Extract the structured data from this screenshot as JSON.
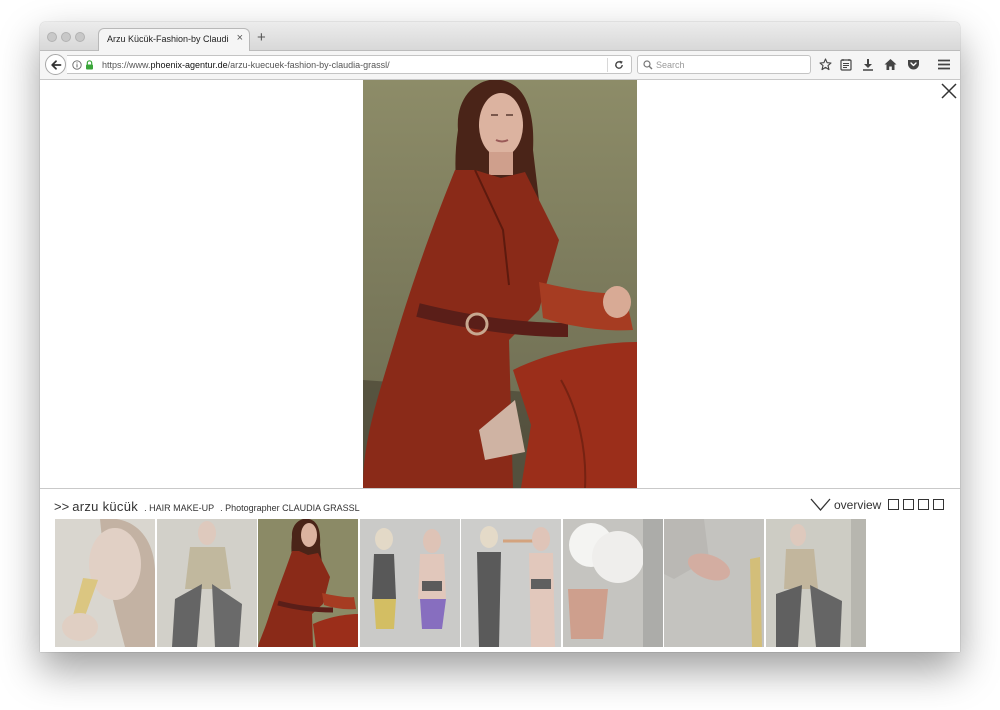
{
  "browser": {
    "tab_title": "Arzu Kücük-Fashion-by Claudia G",
    "tab_close": "×",
    "new_tab": "+",
    "url_prefix": "https://www.",
    "url_host": "phoenix-agentur.de",
    "url_path": "/arzu-kuecuek-fashion-by-claudia-grassl/",
    "search_placeholder": "Search"
  },
  "gallery": {
    "caption_arrow": ">>",
    "model_name": "arzu kücük",
    "credit_hair": ". HAIR MAKE-UP",
    "credit_photographer": ". Photographer CLAUDIA GRASSL",
    "overview_label": "overview",
    "view_options": 4,
    "thumbnail_count": 8,
    "active_thumbnail": 3
  },
  "colors": {
    "coat": "#8a2a18",
    "photo_bg": "#8f8e69",
    "thumb_dim": "#bdbdbd"
  }
}
